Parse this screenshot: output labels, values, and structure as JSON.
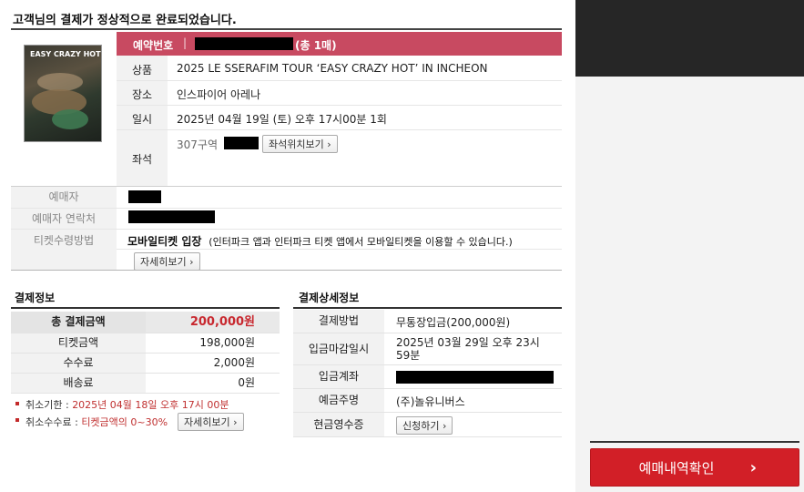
{
  "headline": "고객님의 결제가 정상적으로 완료되었습니다.",
  "poster": {
    "title": "EASY CRAZY HOT",
    "accent": "#5a5140"
  },
  "reservation": {
    "key": "예약번호",
    "separator": "|",
    "count": "(총 1매)",
    "bar_color": "#c84a61"
  },
  "details": {
    "product_key": "상품",
    "product_val": "2025 LE SSERAFIM TOUR ‘EASY CRAZY HOT’ IN INCHEON",
    "venue_key": "장소",
    "venue_val": "인스파이어 아레나",
    "date_key": "일시",
    "date_val": "2025년 04월 19일 (토) 오후 17시00분 1회",
    "seat_key": "좌석",
    "seat_val": "307구역",
    "seat_button": "좌석위치보기 ›"
  },
  "buyer": {
    "name_key": "예매자",
    "contact_key": "예매자 연락처",
    "receive_key": "티켓수령방법",
    "receive_val_bold": "모바일티켓 입장",
    "receive_val_note": "(인터파크 앱과 인터파크 티켓 앱에서 모바일티켓을 이용할 수 있습니다.)",
    "detail_button": "자세히보기 ›"
  },
  "payment": {
    "title": "결제정보",
    "rows": [
      {
        "label": "총 결제금액",
        "value": "200,000원"
      },
      {
        "label": "티켓금액",
        "value": "198,000원"
      },
      {
        "label": "수수료",
        "value": "2,000원"
      },
      {
        "label": "배송료",
        "value": "0원"
      }
    ],
    "cancel_deadline_label": "취소기한 :",
    "cancel_deadline_value": "2025년 04월 18일 오후 17시 00분",
    "cancel_fee_label": "취소수수료 :",
    "cancel_fee_value": "티켓금액의 0~30%",
    "cancel_fee_button": "자세히보기 ›"
  },
  "payment_detail": {
    "title": "결제상세정보",
    "method_key": "결제방법",
    "method_val": "무통장입금(200,000원)",
    "deadline_key": "입금마감일시",
    "deadline_val_1": "2025년 03월 29일 오후 23시",
    "deadline_val_2": "59분",
    "account_key": "입금계좌",
    "depositor_key": "예금주명",
    "depositor_val": "(주)놀유니버스",
    "receipt_key": "현금영수증",
    "receipt_button": "신청하기 ›"
  },
  "confirm_button": {
    "label": "예매내역확인",
    "arrow": "›",
    "color": "#d21f27"
  }
}
